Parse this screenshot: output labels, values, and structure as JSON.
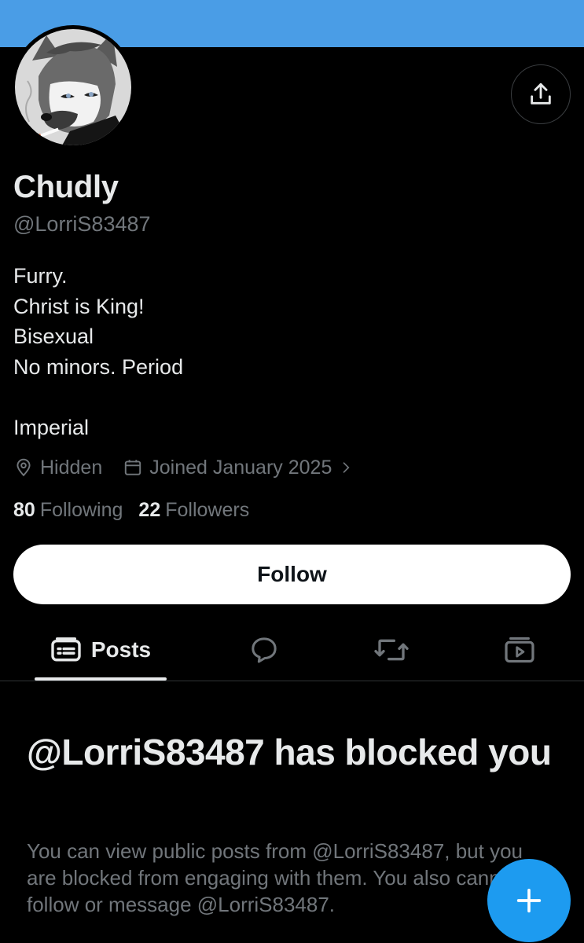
{
  "colors": {
    "banner": "#4a9de6",
    "background": "#000000",
    "text_primary": "#e7e9ea",
    "text_secondary": "#71767b",
    "accent": "#1d9bf0",
    "follow_button_bg": "#ffffff"
  },
  "header": {
    "avatar_icon": "avatar-image",
    "share_icon": "share-upload-icon"
  },
  "profile": {
    "display_name": "Chudly",
    "handle": "@LorriS83487",
    "bio_lines": [
      "Furry.",
      "Christ is King!",
      "Bisexual",
      "No minors. Period",
      "",
      "Imperial"
    ],
    "location": "Hidden",
    "joined": "Joined January 2025",
    "following_count": "80",
    "following_label": "Following",
    "followers_count": "22",
    "followers_label": "Followers"
  },
  "actions": {
    "follow_label": "Follow"
  },
  "tabs": [
    {
      "label": "Posts",
      "icon": "posts-icon",
      "active": true
    },
    {
      "label": "",
      "icon": "replies-bubble-icon",
      "active": false
    },
    {
      "label": "",
      "icon": "reposts-icon",
      "active": false
    },
    {
      "label": "",
      "icon": "media-video-icon",
      "active": false
    }
  ],
  "blocked_notice": {
    "title": "@LorriS83487 has blocked you",
    "body": "You can view public posts from @LorriS83487, but you are blocked from engaging with them. You also cannot follow or message @LorriS83487."
  },
  "fab": {
    "icon": "plus-icon"
  }
}
